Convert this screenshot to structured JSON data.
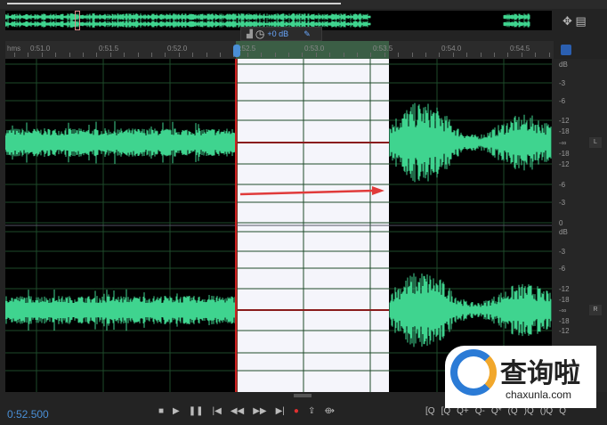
{
  "overview": {
    "icons": [
      "zoom-navigator-icon",
      "menu-icon"
    ]
  },
  "hud": {
    "volume_label": "+0 dB"
  },
  "ruler": {
    "unit": "hms",
    "labels": [
      "0:51.0",
      "0:51.5",
      "0:52.0",
      "0:52.5",
      "0:53.0",
      "0:53.5",
      "0:54.0",
      "0:54.5"
    ],
    "selection": {
      "start": "0:52.5",
      "end": "0:53.6"
    }
  },
  "db_scale": {
    "ch1": [
      "dB",
      "-3",
      "-6",
      "-12",
      "-18",
      "-∞",
      "-18",
      "-12",
      "-6",
      "-3",
      "0"
    ],
    "ch2": [
      "dB",
      "-3",
      "-6",
      "-12",
      "-18",
      "-∞",
      "-18",
      "-12"
    ],
    "channel_labels": [
      "L",
      "R"
    ]
  },
  "colors": {
    "waveform": "#3fd48f",
    "selection": "#f5f5fb",
    "playhead": "#cc2222",
    "accent": "#4a8fd6"
  },
  "status": {
    "time": "0:52.500"
  },
  "transport": [
    "■",
    "▶",
    "❚❚",
    "|◀",
    "◀◀",
    "▶▶",
    "▶|",
    "●",
    "⇪",
    "⟴"
  ],
  "zoom_controls": [
    "[Q",
    "[Q",
    "Q+",
    "Q-",
    "Q*",
    "(Q",
    ")Q",
    "()Q",
    "Q"
  ],
  "watermark": {
    "text": "查询啦",
    "url": "chaxunla.com"
  }
}
